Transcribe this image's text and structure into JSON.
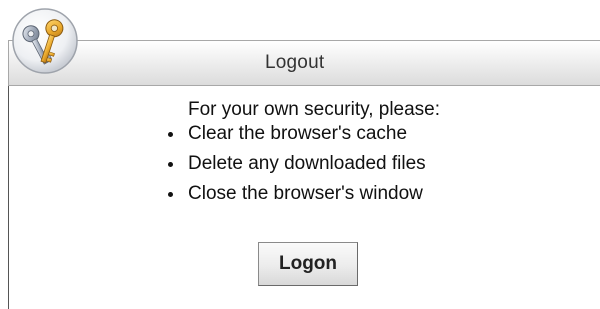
{
  "header": {
    "title": "Logout",
    "icon": "keys-icon"
  },
  "content": {
    "message": "For your own security, please:",
    "steps": [
      "Clear the browser's cache",
      "Delete any downloaded files",
      "Close the browser's window"
    ]
  },
  "actions": {
    "logon_label": "Logon"
  },
  "colors": {
    "key_gold": "#e8a628",
    "key_silver": "#9aa4b4",
    "header_gradient_top": "#ffffff",
    "header_gradient_bottom": "#dcdcdc"
  }
}
